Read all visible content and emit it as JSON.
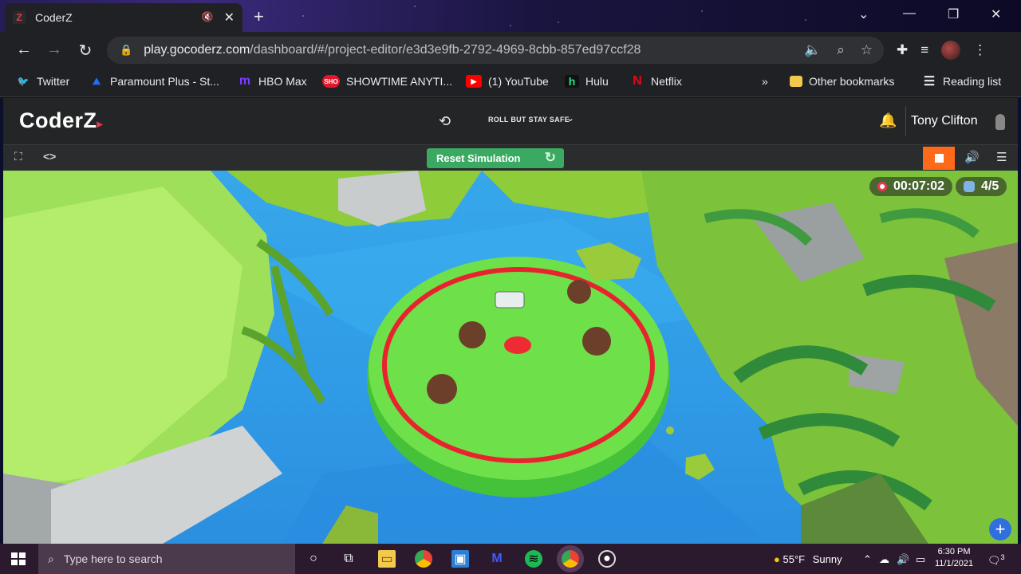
{
  "browser": {
    "tab_title": "CoderZ",
    "tab_favicon": "Z",
    "url_host": "play.gocoderz.com",
    "url_path": "/dashboard/#/project-editor/e3d3e9fb-2792-4969-8cbb-857ed97ccf28",
    "bookmarks": [
      {
        "label": "Twitter",
        "icon": "twitter-icon",
        "color": "#1d9bf0",
        "glyph": "🐦"
      },
      {
        "label": "Paramount Plus - St...",
        "icon": "paramount-icon",
        "color": "#1f6fff",
        "glyph": "⛰"
      },
      {
        "label": "HBO Max",
        "icon": "hbomax-icon",
        "color": "#7a3cff",
        "glyph": "m"
      },
      {
        "label": "SHOWTIME ANYTI...",
        "icon": "showtime-icon",
        "color": "#e3172c",
        "glyph": "SHO"
      },
      {
        "label": "(1) YouTube",
        "icon": "youtube-icon",
        "color": "#ff0000",
        "glyph": "▶"
      },
      {
        "label": "Hulu",
        "icon": "hulu-icon",
        "color": "#1ce783",
        "glyph": "h"
      },
      {
        "label": "Netflix",
        "icon": "netflix-icon",
        "color": "#e50914",
        "glyph": "N"
      }
    ],
    "overflow": "»",
    "other_bookmarks": "Other bookmarks",
    "reading_list": "Reading list"
  },
  "app": {
    "logo": "CoderZ",
    "mission": "ROLL BUT STAY SAFE",
    "user_name": "Tony Clifton",
    "reset_label": "Reset Simulation",
    "timer": "00:07:02",
    "score": "4/5",
    "colors": {
      "accent": "#3aaa62",
      "stop": "#ff6a1a",
      "brand_red": "#e8384f"
    }
  },
  "taskbar": {
    "search_placeholder": "Type here to search",
    "weather_temp": "55°F",
    "weather_desc": "Sunny",
    "time": "6:30 PM",
    "date": "11/1/2021",
    "notifications": "3"
  }
}
